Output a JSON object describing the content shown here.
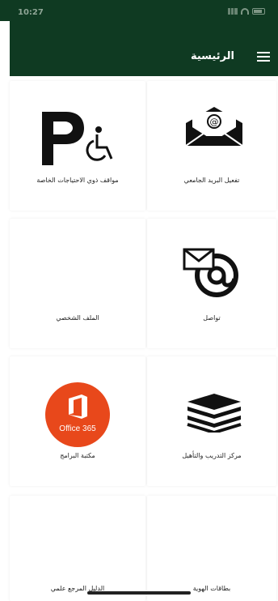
{
  "status_bar": {
    "time": "10:27"
  },
  "header": {
    "title": "الرئيسية",
    "menu_icon": "hamburger-menu-icon"
  },
  "tiles": [
    {
      "label": "تفعيل البريد الجامعي",
      "icon": "email-envelope-icon"
    },
    {
      "label": "مواقف ذوي الاحتياجات الخاصة",
      "icon": "accessible-parking-icon"
    },
    {
      "label": "تواصل",
      "icon": "mail-at-contact-icon"
    },
    {
      "label": "الملف الشخصي",
      "icon": ""
    },
    {
      "label": "مركز التدريب والتأهيل",
      "icon": "stacked-books-icon"
    },
    {
      "label": "مكتبة البرامج",
      "icon": "office-365-icon",
      "office_text": "Office 365"
    },
    {
      "label": "بطاقات الهوية",
      "icon": ""
    },
    {
      "label": "الدليل المرجع علمي",
      "icon": ""
    }
  ],
  "colors": {
    "header_bg": "#0f3a22",
    "office_orange": "#e8481b"
  }
}
